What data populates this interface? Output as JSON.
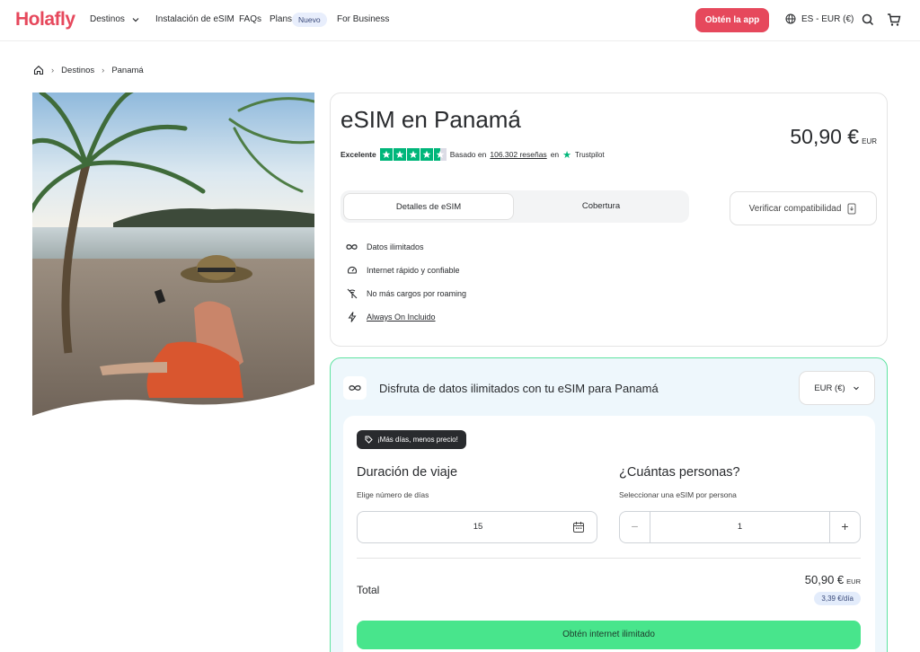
{
  "header": {
    "logo": "Holafly",
    "nav": {
      "destinos": "Destinos",
      "instalacion": "Instalación de eSIM",
      "faqs": "FAQs",
      "plans": "Plans",
      "plans_badge": "Nuevo",
      "business": "For Business"
    },
    "app_button": "Obtén la app",
    "language": "ES - EUR (€)"
  },
  "breadcrumb": {
    "items": [
      "Destinos",
      "Panamá"
    ]
  },
  "product": {
    "title": "eSIM en Panamá",
    "rating_label": "Excelente",
    "reviews_prefix": "Basado en",
    "reviews_count": "106.302 reseñas",
    "reviews_suffix": "en",
    "trustpilot": "Trustpilot",
    "price": "50,90 €",
    "currency_code": "EUR",
    "tabs": [
      "Detalles de eSIM",
      "Cobertura"
    ],
    "verify_button": "Verificar compatibilidad",
    "features": [
      {
        "icon": "infinity-icon",
        "label": "Datos ilimitados"
      },
      {
        "icon": "speedometer-icon",
        "label": "Internet rápido y confiable"
      },
      {
        "icon": "no-roaming-icon",
        "label": "No más cargos por roaming"
      },
      {
        "icon": "lightning-icon",
        "label": "Always On Incluido"
      }
    ]
  },
  "plan": {
    "heading": "Disfruta de datos ilimitados con tu eSIM para Panamá",
    "currency_select": "EUR (€)",
    "promo": "¡Más días, menos precio!",
    "duration_title": "Duración de viaje",
    "duration_sub": "Elige número de días",
    "duration_value": "15",
    "people_title": "¿Cuántas personas?",
    "people_sub": "Seleccionar una eSIM por persona",
    "people_value": "1",
    "minus": "−",
    "plus": "+",
    "total_label": "Total",
    "total_value": "50,90 €",
    "total_currency": "EUR",
    "per_day": "3,39 €/día",
    "cta": "Obtén internet ilimitado"
  },
  "colors": {
    "brand": "#e6485c",
    "cta_green": "#48e58c",
    "trustpilot_green": "#00b67a",
    "plan_border": "#5ee3a1"
  }
}
